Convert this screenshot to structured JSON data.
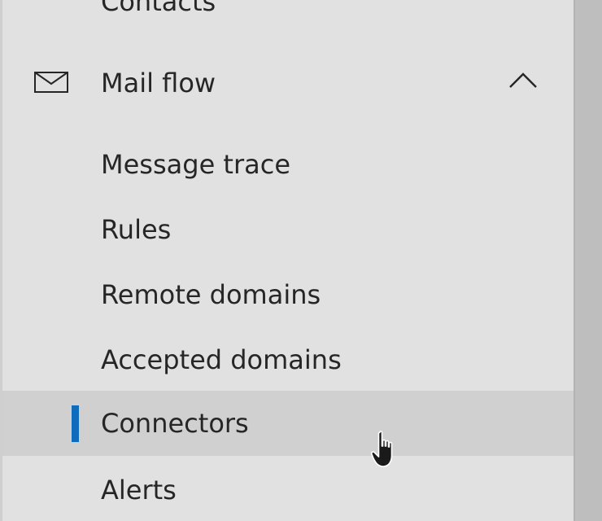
{
  "nav": {
    "partial_item": {
      "label": "Contacts"
    },
    "mail_flow": {
      "label": "Mail flow",
      "icon": "mail-icon",
      "expanded": true,
      "toggle_icon": "chevron-up-icon",
      "children": [
        {
          "label": "Message trace"
        },
        {
          "label": "Rules"
        },
        {
          "label": "Remote domains"
        },
        {
          "label": "Accepted domains"
        },
        {
          "label": "Connectors",
          "selected": true
        },
        {
          "label": "Alerts"
        }
      ]
    }
  },
  "colors": {
    "background": "#e1e1e1",
    "selected_row": "#d0d0d0",
    "selection_indicator": "#0f6cbd",
    "text": "#262626",
    "scrollbar_rail": "#bebebe"
  },
  "cursor": {
    "type": "hand-pointer",
    "icon": "hand-pointer-icon"
  }
}
